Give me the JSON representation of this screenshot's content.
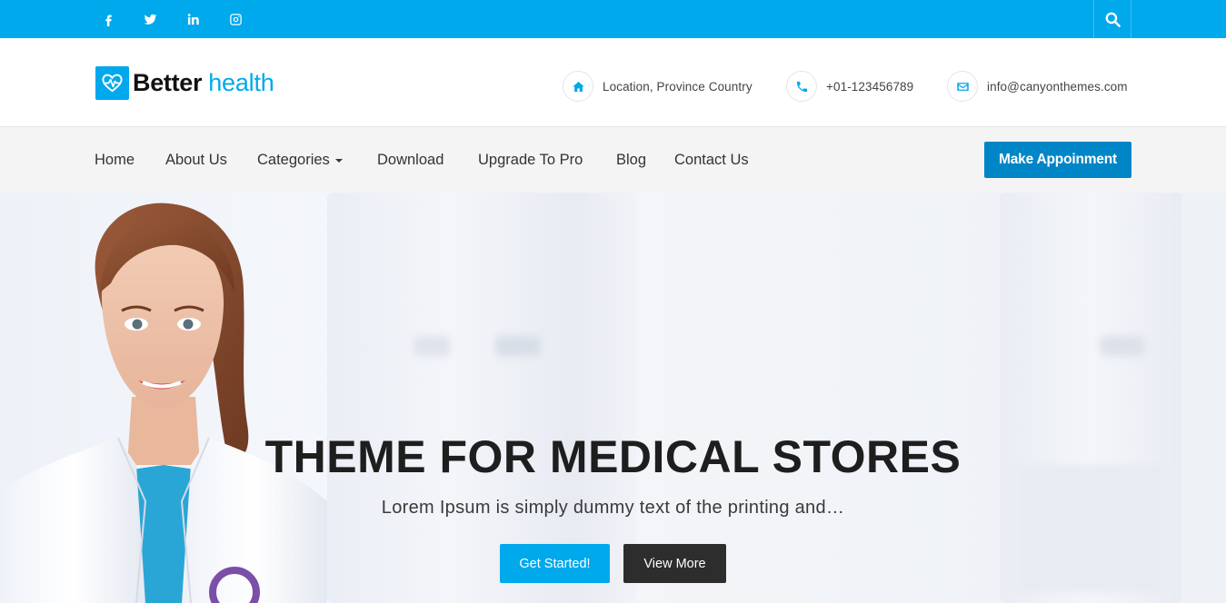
{
  "colors": {
    "brand_blue": "#00a8ec",
    "button_blue": "#0086c6",
    "dark_button": "#2d2d2d",
    "nav_bg": "#f4f4f4"
  },
  "topbar": {
    "social": [
      {
        "name": "facebook-icon"
      },
      {
        "name": "twitter-icon"
      },
      {
        "name": "linkedin-icon"
      },
      {
        "name": "instagram-icon"
      }
    ],
    "search_icon": "search-icon"
  },
  "header": {
    "logo_word_1": "Better",
    "logo_word_2": "health",
    "logo_icon": "heart-pulse-icon",
    "contacts": [
      {
        "icon": "home-icon",
        "text": "Location, Province Country"
      },
      {
        "icon": "phone-icon",
        "text": "+01-123456789"
      },
      {
        "icon": "envelope-icon",
        "text": "info@canyonthemes.com"
      }
    ]
  },
  "nav": {
    "items": [
      {
        "label": "Home"
      },
      {
        "label": "About Us"
      },
      {
        "label": "Categories"
      },
      {
        "label": "Download"
      },
      {
        "label": "Upgrade To Pro"
      },
      {
        "label": "Blog"
      },
      {
        "label": "Contact Us"
      }
    ],
    "cta_label": "Make Appoinment"
  },
  "hero": {
    "title": "THEME FOR MEDICAL STORES",
    "subtitle": "Lorem Ipsum is simply dummy text of the printing and…",
    "primary_button": "Get Started!",
    "secondary_button": "View More"
  }
}
